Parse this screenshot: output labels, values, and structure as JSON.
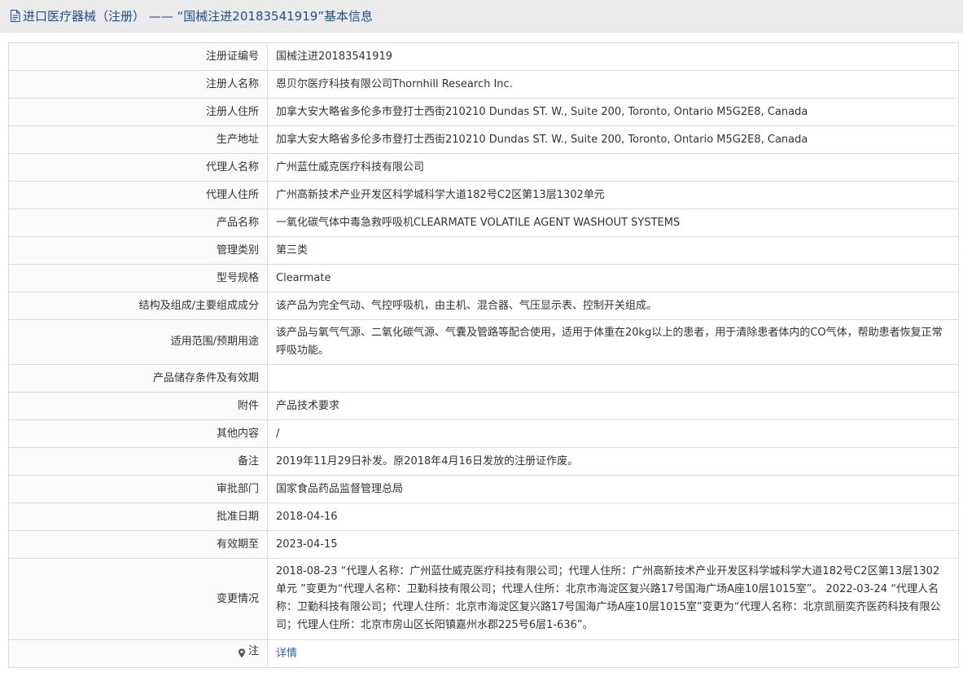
{
  "header": {
    "icon": "document-icon",
    "title": "进口医疗器械（注册） ——  “国械注进20183541919”基本信息"
  },
  "rows": [
    {
      "label": "注册证编号",
      "value": "国械注进20183541919"
    },
    {
      "label": "注册人名称",
      "value": "恩贝尔医疗科技有限公司Thornhill Research Inc."
    },
    {
      "label": "注册人住所",
      "value": "加拿大安大略省多伦多市登打士西街210210 Dundas ST. W., Suite 200, Toronto, Ontario M5G2E8, Canada"
    },
    {
      "label": "生产地址",
      "value": "加拿大安大略省多伦多市登打士西街210210 Dundas ST. W., Suite 200, Toronto, Ontario M5G2E8, Canada"
    },
    {
      "label": "代理人名称",
      "value": "广州蓝仕威克医疗科技有限公司"
    },
    {
      "label": "代理人住所",
      "value": "广州高新技术产业开发区科学城科学大道182号C2区第13层1302单元"
    },
    {
      "label": "产品名称",
      "value": "一氧化碳气体中毒急救呼吸机CLEARMATE VOLATILE AGENT WASHOUT SYSTEMS"
    },
    {
      "label": "管理类别",
      "value": "第三类"
    },
    {
      "label": "型号规格",
      "value": "Clearmate"
    },
    {
      "label": "结构及组成/主要组成成分",
      "value": "该产品为完全气动、气控呼吸机，由主机、混合器、气压显示表、控制开关组成。"
    },
    {
      "label": "适用范围/预期用途",
      "value": "该产品与氧气气源、二氧化碳气源、气囊及管路等配合使用，适用于体重在20kg以上的患者，用于清除患者体内的CO气体，帮助患者恢复正常呼吸功能。"
    },
    {
      "label": "产品储存条件及有效期",
      "value": ""
    },
    {
      "label": "附件",
      "value": "产品技术要求"
    },
    {
      "label": "其他内容",
      "value": "/"
    },
    {
      "label": "备注",
      "value": "2019年11月29日补发。原2018年4月16日发放的注册证作废。"
    },
    {
      "label": "审批部门",
      "value": "国家食品药品监督管理总局"
    },
    {
      "label": "批准日期",
      "value": "2018-04-16"
    },
    {
      "label": "有效期至",
      "value": "2023-04-15"
    },
    {
      "label": "变更情况",
      "value": "2018-08-23 “代理人名称：广州蓝仕威克医疗科技有限公司；代理人住所：广州高新技术产业开发区科学城科学大道182号C2区第13层1302单元 ”变更为“代理人名称：卫勤科技有限公司；代理人住所：北京市海淀区复兴路17号国海广场A座10层1015室”。 2022-03-24 “代理人名称：卫勤科技有限公司；代理人住所：北京市海淀区复兴路17号国海广场A座10层1015室”变更为“代理人名称：北京凯丽奕齐医药科技有限公司；代理人住所：北京市房山区长阳镇嘉州水郡225号6层1-636”。"
    }
  ],
  "note": {
    "icon": "pin-icon",
    "label": "注",
    "link_text": "详情"
  },
  "colors": {
    "title": "#1f4e8c",
    "link": "#2a62b8",
    "border": "#dcdcdc",
    "header_bg": "#ebebeb"
  }
}
